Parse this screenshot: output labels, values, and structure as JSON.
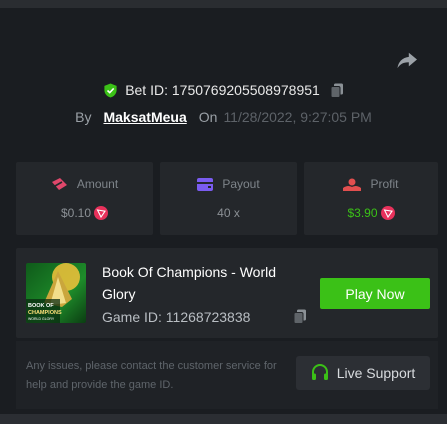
{
  "bet": {
    "label": "Bet ID:",
    "id": "1750769205508978951",
    "by_label": "By",
    "user": "MaksatMeua",
    "on_label": "On",
    "date": "11/28/2022, 9:27:05 PM"
  },
  "stats": {
    "amount": {
      "label": "Amount",
      "value": "$0.10"
    },
    "payout": {
      "label": "Payout",
      "value": "40 x"
    },
    "profit": {
      "label": "Profit",
      "value": "$3.90"
    }
  },
  "game": {
    "title": "Book Of Champions - World Glory",
    "id_label": "Game ID:",
    "id": "11268723838",
    "play_label": "Play Now",
    "thumb_text": [
      "BOOK OF",
      "CHAMPIONS",
      "WORLD GLORY"
    ]
  },
  "support": {
    "text": "Any issues, please contact the customer service for help and provide the game ID.",
    "button_label": "Live Support"
  },
  "icons": {
    "share": "share-icon",
    "shield": "shield-check-icon",
    "copy": "copy-icon",
    "amount": "coins-icon",
    "payout": "wallet-icon",
    "profit": "profit-icon",
    "currency": "trx-icon",
    "headset": "headset-icon"
  },
  "colors": {
    "background": "#1a1d21",
    "card": "#24272b",
    "accent_green": "#3bc117",
    "amount_icon": "#e0476b",
    "payout_icon": "#7a5cf0",
    "profit_icon": "#e24f4f",
    "profit_value": "#3bc117",
    "trx_red": "#e8315b"
  }
}
